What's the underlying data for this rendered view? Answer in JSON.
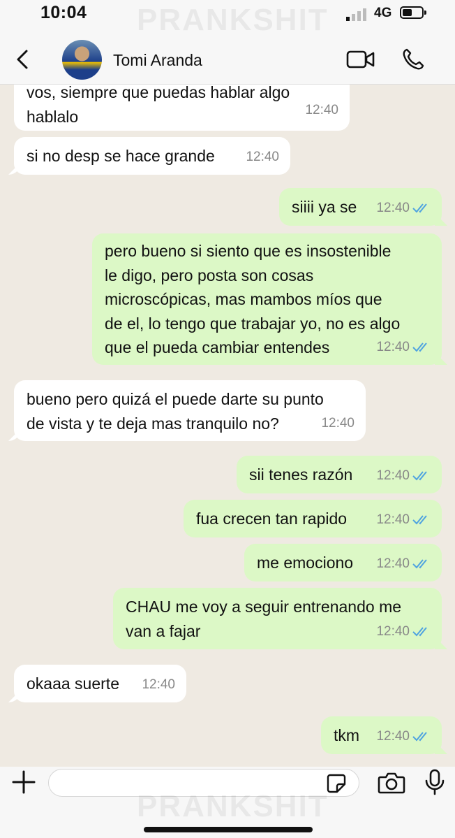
{
  "status_bar": {
    "time": "10:04",
    "network": "4G",
    "watermark": "PRANKSHIT"
  },
  "header": {
    "contact_name": "Tomi Aranda"
  },
  "messages": [
    {
      "dir": "in",
      "text": "vos, siempre que puedas hablar algo\nhablalo",
      "time": "12:40"
    },
    {
      "dir": "in",
      "text": "si no desp se hace grande",
      "time": "12:40"
    },
    {
      "dir": "out",
      "text": "siiii ya se",
      "time": "12:40"
    },
    {
      "dir": "out",
      "text": "pero bueno si siento que es insostenible\nle digo, pero posta son cosas\nmicroscópicas, mas mambos míos que\nde el, lo tengo que trabajar yo, no es algo\nque el pueda cambiar entendes",
      "time": "12:40"
    },
    {
      "dir": "in",
      "text": "bueno pero quizá el puede darte su punto\nde vista y te deja mas tranquilo no?",
      "time": "12:40"
    },
    {
      "dir": "out",
      "text": "sii tenes razón",
      "time": "12:40"
    },
    {
      "dir": "out",
      "text": "fua crecen tan rapido",
      "time": "12:40"
    },
    {
      "dir": "out",
      "text": "me emociono",
      "time": "12:40"
    },
    {
      "dir": "out",
      "text": "CHAU me voy a seguir entrenando me\nvan a fajar",
      "time": "12:40"
    },
    {
      "dir": "in",
      "text": "okaaa suerte",
      "time": "12:40"
    },
    {
      "dir": "out",
      "text": "tkm",
      "time": "12:40"
    }
  ],
  "colors": {
    "incoming": "#ffffff",
    "outgoing": "#dcf8c6",
    "read_ticks": "#4fa3e0",
    "background": "#efeae2"
  },
  "icons": [
    "back-icon",
    "video-call-icon",
    "phone-icon",
    "plus-icon",
    "sticker-icon",
    "camera-icon",
    "microphone-icon",
    "double-check-icon"
  ],
  "input": {
    "placeholder": ""
  }
}
